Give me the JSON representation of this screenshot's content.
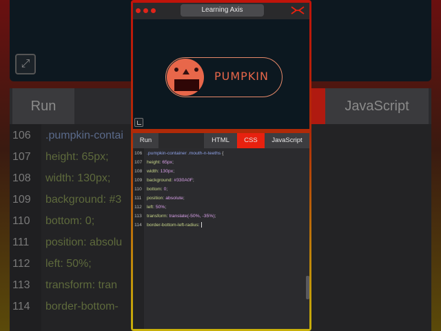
{
  "app": {
    "title": "Learning Axis",
    "window_dots": [
      "close",
      "minimize",
      "maximize"
    ],
    "logo_icon": "axis-logo-icon",
    "accent_red": "#e8210f"
  },
  "preview": {
    "label": "PUMPKIN",
    "pumpkin_color": "#e8674a",
    "mouth_color": "#330A0F",
    "expand_icon": "expand-icon"
  },
  "tabs": {
    "run": "Run",
    "html": "HTML",
    "css": "CSS",
    "js": "JavaScript",
    "active": "CSS"
  },
  "code": [
    {
      "n": "106",
      "sel": ".pumpkin-container .mouth-n-teeths",
      "rest": " {"
    },
    {
      "n": "107",
      "prop": "height",
      "val": "65px"
    },
    {
      "n": "108",
      "prop": "width",
      "val": "130px"
    },
    {
      "n": "109",
      "prop": "background",
      "val": "#330A0F"
    },
    {
      "n": "110",
      "prop": "bottom",
      "val": "0"
    },
    {
      "n": "111",
      "prop": "position",
      "val": "absolute"
    },
    {
      "n": "112",
      "prop": "left",
      "val": "50%"
    },
    {
      "n": "113",
      "prop": "transform",
      "val": "translate(-50%, -35%)"
    },
    {
      "n": "114",
      "prop": "border-bottom-left-radius",
      "val": "",
      "caret": true
    }
  ],
  "background_echo": {
    "run": "Run",
    "js": "JavaScript",
    "lines": [
      {
        "n": "106",
        "t": ".pumpkin-contai"
      },
      {
        "n": "107",
        "t": "height: 65px;"
      },
      {
        "n": "108",
        "t": "width: 130px;"
      },
      {
        "n": "109",
        "t": "background: #3"
      },
      {
        "n": "110",
        "t": "bottom: 0;"
      },
      {
        "n": "111",
        "t": "position: absolu"
      },
      {
        "n": "112",
        "t": "left: 50%;"
      },
      {
        "n": "113",
        "t": "transform: tran"
      },
      {
        "n": "114",
        "t": "border-bottom-"
      }
    ]
  }
}
